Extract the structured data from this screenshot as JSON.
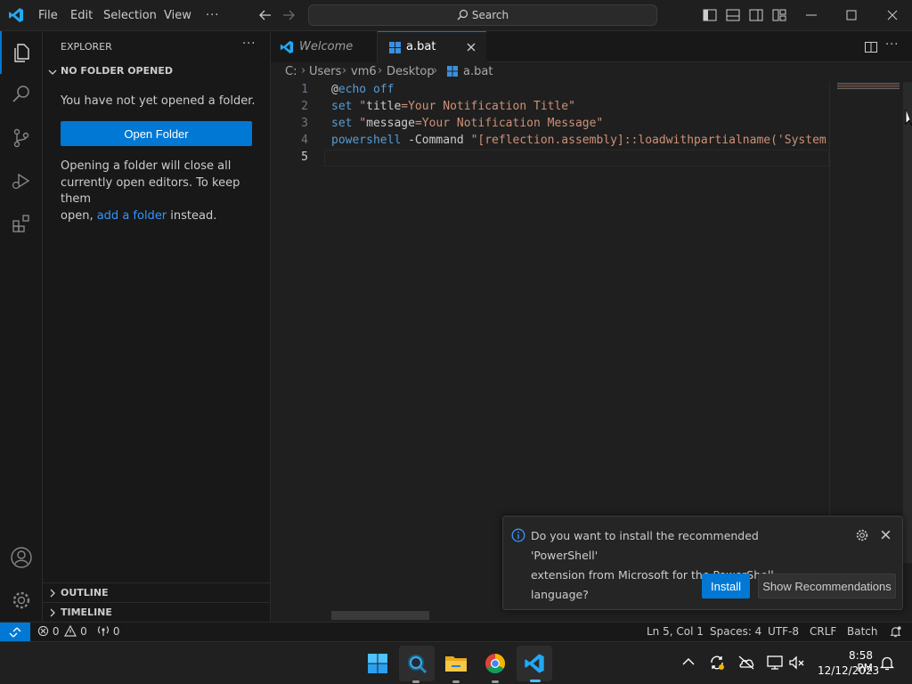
{
  "titlebar": {
    "menu": [
      "File",
      "Edit",
      "Selection",
      "View"
    ],
    "more": "···",
    "search_label": "Search"
  },
  "sidebar": {
    "header": "EXPLORER",
    "more": "···",
    "section_title": "NO FOLDER OPENED",
    "message": "You have not yet opened a folder.",
    "open_folder_label": "Open Folder",
    "hint_line1": "Opening a folder will close all",
    "hint_line2": "currently open editors. To keep them",
    "hint_prefix": "open, ",
    "hint_link": "add a folder",
    "hint_suffix": " instead.",
    "outline_label": "OUTLINE",
    "timeline_label": "TIMELINE"
  },
  "tabs": [
    {
      "label": "Welcome",
      "active": false
    },
    {
      "label": "a.bat",
      "active": true
    }
  ],
  "breadcrumb": {
    "parts": [
      "C:",
      "Users",
      "vm6",
      "Desktop"
    ],
    "file": "a.bat"
  },
  "editor": {
    "line_numbers": [
      "1",
      "2",
      "3",
      "4",
      "5"
    ],
    "lines": [
      [
        {
          "t": "@",
          "c": "#cccccc"
        },
        {
          "t": "echo off",
          "c": "#569cd6"
        }
      ],
      [
        {
          "t": "set ",
          "c": "#569cd6"
        },
        {
          "t": "\"",
          "c": "#ce9178"
        },
        {
          "t": "title",
          "c": "#cccccc"
        },
        {
          "t": "=Your Notification Title\"",
          "c": "#ce9178"
        }
      ],
      [
        {
          "t": "set ",
          "c": "#569cd6"
        },
        {
          "t": "\"",
          "c": "#ce9178"
        },
        {
          "t": "message",
          "c": "#cccccc"
        },
        {
          "t": "=Your Notification Message\"",
          "c": "#ce9178"
        }
      ],
      [
        {
          "t": "powershell",
          "c": "#569cd6"
        },
        {
          "t": " -Command ",
          "c": "#cccccc"
        },
        {
          "t": "\"[reflection.assembly]::loadwithpartialname('System.W",
          "c": "#ce9178"
        }
      ],
      [
        {
          "t": "",
          "c": "#cccccc"
        }
      ]
    ]
  },
  "notification": {
    "line1": "Do you want to install the recommended 'PowerShell'",
    "line2": "extension from Microsoft for the PowerShell language?",
    "install_label": "Install",
    "recommend_label": "Show Recommendations"
  },
  "statusbar": {
    "errors": "0",
    "warnings": "0",
    "ports": "0",
    "position": "Ln 5, Col 1",
    "spaces": "Spaces: 4",
    "encoding": "UTF-8",
    "eol": "CRLF",
    "language": "Batch"
  },
  "taskbar": {
    "time": "8:58 PM",
    "date": "12/12/2023"
  },
  "colors": {
    "accent": "#0078d4",
    "link": "#3794ff",
    "keyword": "#569cd6",
    "string": "#ce9178"
  }
}
